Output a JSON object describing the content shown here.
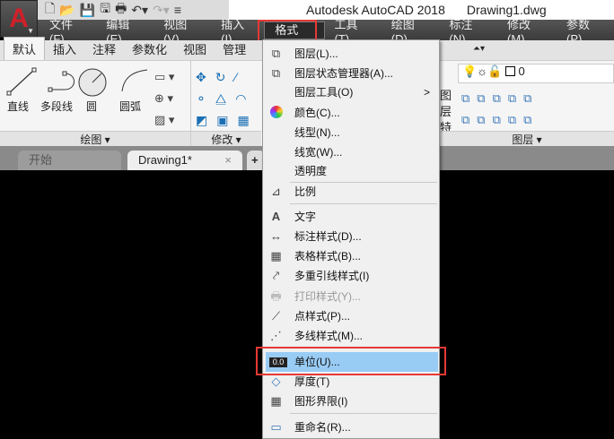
{
  "title": {
    "app": "Autodesk AutoCAD 2018",
    "file": "Drawing1.dwg"
  },
  "logo": "A",
  "qat": [
    "new-icon",
    "open-icon",
    "save-icon",
    "saveas-icon",
    "print-icon",
    "undo-icon",
    "redo-icon"
  ],
  "menubar": [
    "文件(F)",
    "编辑(E)",
    "视图(V)",
    "插入(I)",
    "格式(O)",
    "工具(T)",
    "绘图(D)",
    "标注(N)",
    "修改(M)",
    "参数(P)"
  ],
  "ribbon_tabs": [
    "默认",
    "插入",
    "注释",
    "参数化",
    "视图",
    "管理"
  ],
  "ribbon": {
    "tools": [
      "直线",
      "多段线",
      "圆",
      "圆弧"
    ],
    "panels": {
      "draw": "绘图 ▾",
      "modify": "修改 ▾",
      "layer": "图层 ▾"
    },
    "layer_props": "图层特性",
    "layer_value": "0"
  },
  "doc_tabs": {
    "start": "开始",
    "drawing": "Drawing1*",
    "close": "×",
    "add": "+"
  },
  "format_menu": [
    {
      "label": "图层(L)...",
      "icon": "layer-icon"
    },
    {
      "label": "图层状态管理器(A)...",
      "icon": "layer-state-icon"
    },
    {
      "label": "图层工具(O)",
      "icon": "",
      "submenu": true
    },
    {
      "label": "颜色(C)...",
      "icon": "color-wheel-icon"
    },
    {
      "label": "线型(N)...",
      "icon": ""
    },
    {
      "label": "线宽(W)...",
      "icon": ""
    },
    {
      "label": "透明度",
      "icon": ""
    },
    {
      "label": "比例",
      "icon": "scale-icon"
    },
    {
      "label": "文字",
      "icon": "text-style-icon"
    },
    {
      "label": "标注样式(D)...",
      "icon": "dim-style-icon"
    },
    {
      "label": "表格样式(B)...",
      "icon": "table-style-icon"
    },
    {
      "label": "多重引线样式(I)",
      "icon": "mleader-style-icon"
    },
    {
      "label": "打印样式(Y)...",
      "icon": "plot-style-icon",
      "disabled": true
    },
    {
      "label": "点样式(P)...",
      "icon": "point-style-icon"
    },
    {
      "label": "多线样式(M)...",
      "icon": "mline-style-icon"
    },
    {
      "label": "单位(U)...",
      "icon": "units-icon",
      "highlighted": true
    },
    {
      "label": "厚度(T)",
      "icon": "thickness-icon"
    },
    {
      "label": "图形界限(I)",
      "icon": "limits-icon"
    },
    {
      "label": "重命名(R)...",
      "icon": "rename-icon"
    }
  ],
  "submenu_arrow": ">",
  "units_icon_text": "0.0"
}
